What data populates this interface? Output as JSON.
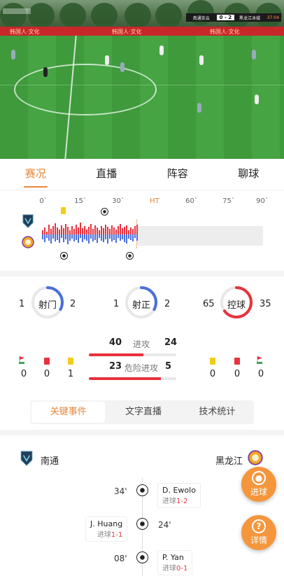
{
  "video": {
    "scoreboard": {
      "home": "南通支云",
      "score": "0 - 2",
      "away": "黑龙江冰城",
      "clock": "37:04"
    },
    "adboard": [
      "韩国人·文化",
      "韩国人·文化",
      "韩国人·文化"
    ]
  },
  "tabs": [
    "赛况",
    "直播",
    "阵容",
    "聊球"
  ],
  "momentum": {
    "minute_labels": [
      "0`",
      "15`",
      "30`",
      "HT",
      "60`",
      "75`",
      "90`"
    ],
    "home_bars": [
      6,
      10,
      4,
      14,
      8,
      12,
      16,
      10,
      7,
      13,
      9,
      15,
      11,
      6,
      12,
      8,
      14,
      10,
      17,
      9,
      12,
      7,
      11,
      15,
      8,
      13,
      10,
      6,
      12,
      9,
      14,
      11,
      8,
      13,
      10,
      7,
      12,
      15,
      9,
      11,
      13,
      6,
      10,
      8,
      12,
      14
    ],
    "away_bars": [
      8,
      12,
      6,
      10,
      14,
      7,
      11,
      9,
      13,
      6,
      12,
      8,
      15,
      10,
      7,
      11,
      9,
      13,
      6,
      12,
      8,
      10,
      14,
      7,
      11,
      9,
      13,
      6,
      10,
      12,
      8,
      14,
      7,
      11,
      9,
      13,
      6,
      10,
      8,
      12,
      14,
      7,
      9,
      11,
      6,
      10
    ],
    "colors": {
      "home": "#e8323d",
      "away": "#4a6fd8"
    }
  },
  "stats": {
    "shots": {
      "home": "1",
      "label": "射门",
      "away": "2",
      "home_share": 0.33
    },
    "on_target": {
      "home": "1",
      "label": "射正",
      "away": "2",
      "home_share": 0.33
    },
    "possession": {
      "home": "65",
      "label": "控球",
      "away": "35",
      "home_share": 0.65
    },
    "attacks": {
      "home": "40",
      "label": "进攻",
      "away": "24",
      "home_share": 0.62
    },
    "danger": {
      "home": "23",
      "label": "危险进攻",
      "away": "5",
      "home_share": 0.82
    },
    "corners": {
      "home": "0",
      "away": "0"
    },
    "red_cards": {
      "home": "0",
      "away": "0"
    },
    "yellow_cards": {
      "home": "1",
      "away": "0"
    }
  },
  "segments": [
    "关键事件",
    "文字直播",
    "技术统计"
  ],
  "events_header": {
    "home": "南通",
    "away": "黑龙江"
  },
  "events": [
    {
      "minute": "34'",
      "player": "D. Ewolo",
      "type": "进球",
      "score": "1-2",
      "side": "away"
    },
    {
      "minute": "24'",
      "player": "J. Huang",
      "type": "进球",
      "score": "1-1",
      "side": "home"
    },
    {
      "minute": "08'",
      "player": "P. Yan",
      "type": "进球",
      "score": "0-1",
      "side": "away"
    }
  ],
  "fabs": {
    "goal": "进球",
    "detail": "详情",
    "goal_glyph": "●",
    "detail_glyph": "?"
  }
}
